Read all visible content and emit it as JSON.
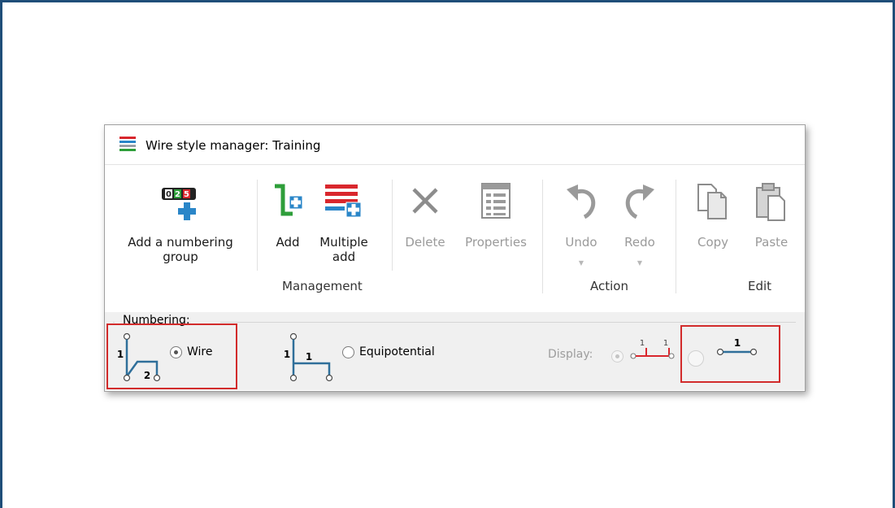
{
  "window": {
    "title": "Wire style manager: Training"
  },
  "ribbon": {
    "tools": [
      {
        "id": "add-numbering-group",
        "label": "Add a numbering\ngroup",
        "icon": "numbering-counter-add-icon",
        "enabled": true
      },
      {
        "id": "add",
        "label": "Add",
        "icon": "add-wire-style-icon",
        "enabled": true
      },
      {
        "id": "multiple-add",
        "label": "Multiple\nadd",
        "icon": "multiple-add-wire-styles-icon",
        "enabled": true
      },
      {
        "id": "delete",
        "label": "Delete",
        "icon": "delete-x-icon",
        "enabled": false
      },
      {
        "id": "properties",
        "label": "Properties",
        "icon": "properties-list-icon",
        "enabled": false
      },
      {
        "id": "undo",
        "label": "Undo",
        "icon": "undo-arrow-icon",
        "enabled": false
      },
      {
        "id": "redo",
        "label": "Redo",
        "icon": "redo-arrow-icon",
        "enabled": false
      },
      {
        "id": "copy",
        "label": "Copy",
        "icon": "copy-pages-icon",
        "enabled": false
      },
      {
        "id": "paste",
        "label": "Paste",
        "icon": "paste-clipboard-icon",
        "enabled": false
      }
    ],
    "groups": {
      "management": "Management",
      "action": "Action",
      "edit": "Edit"
    }
  },
  "numbering": {
    "legend": "Numbering:",
    "wire_option": {
      "label": "Wire",
      "selected": true
    },
    "equipotential_option": {
      "label": "Equipotential",
      "selected": false
    },
    "display_label": "Display:",
    "display_options": [
      {
        "id": "display-each-segment",
        "selected": true,
        "enabled": false
      },
      {
        "id": "display-single",
        "selected": false,
        "enabled": false
      }
    ],
    "diagram_digits": {
      "wire_a": "1",
      "wire_b": "2",
      "equip_a": "1",
      "equip_b": "1",
      "display_a": "1",
      "display_b": "1",
      "display_single": "1"
    }
  },
  "colors": {
    "highlight": "#d22b2b",
    "frame": "#1f4e79",
    "wire_blue": "#2f6f9a",
    "accent_green": "#2e9e3a",
    "accent_red": "#d9272d",
    "plus_blue": "#2a86c8"
  }
}
